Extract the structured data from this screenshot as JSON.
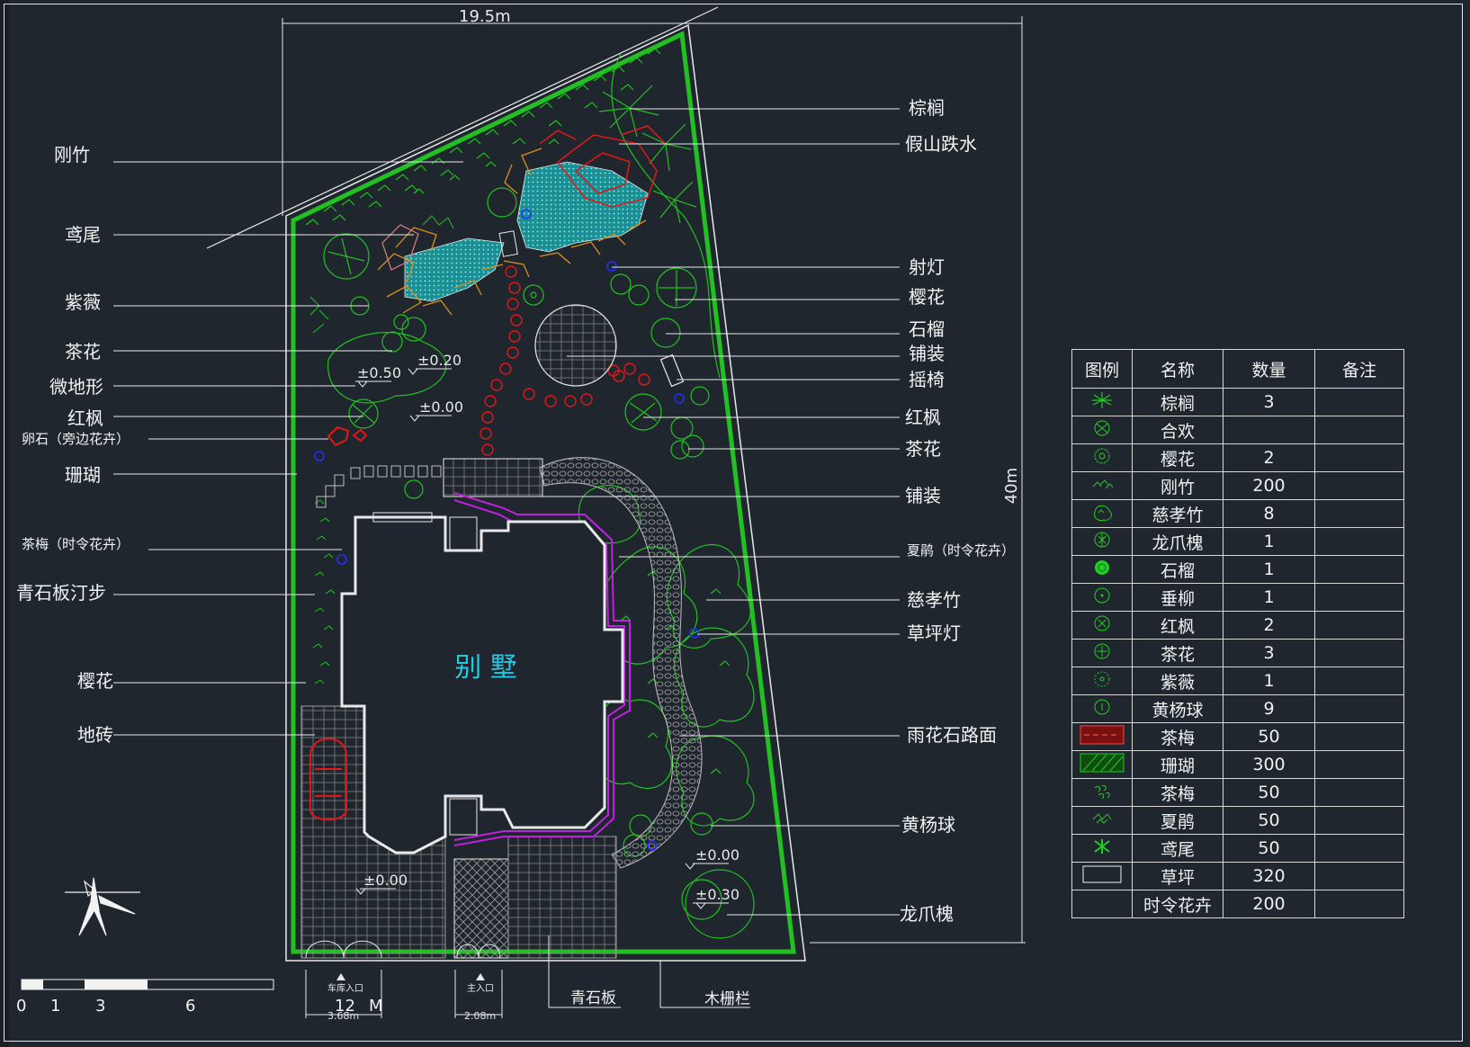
{
  "drawing": {
    "width_dim": "19.5m",
    "height_dim": "40m",
    "villa_label": "别  墅",
    "garage_entrance": "车库入口",
    "main_entrance": "主入口",
    "garage_dim": "3.68m",
    "main_dim": "2.08m",
    "scale_labels": [
      "0",
      "1",
      "3",
      "6",
      "12",
      "M"
    ],
    "elevations": [
      "±0.50",
      "±0.20",
      "±0.00",
      "±0.00",
      "±0.00",
      "±0.30"
    ]
  },
  "left_labels": [
    "刚竹",
    "鸢尾",
    "紫薇",
    "茶花",
    "微地形",
    "红枫",
    "卵石（旁边花卉）",
    "珊瑚",
    "茶梅（时令花卉）",
    "青石板汀步",
    "樱花",
    "地砖"
  ],
  "right_labels": [
    "棕榈",
    "假山跌水",
    "射灯",
    "樱花",
    "石榴",
    "铺装",
    "摇椅",
    "红枫",
    "茶花",
    "铺装",
    "夏鹃（时令花卉）",
    "慈孝竹",
    "草坪灯",
    "雨花石路面",
    "黄杨球",
    "龙爪槐"
  ],
  "bottom_labels": [
    "青石板",
    "木栅栏"
  ],
  "legend": {
    "headers": [
      "图例",
      "名称",
      "数量",
      "备注"
    ],
    "rows": [
      {
        "name": "棕榈",
        "qty": "3",
        "icon": "palm-icon"
      },
      {
        "name": "合欢",
        "qty": "",
        "icon": "albizia-icon"
      },
      {
        "name": "樱花",
        "qty": "2",
        "icon": "cherry-icon"
      },
      {
        "name": "刚竹",
        "qty": "200",
        "icon": "bamboo-icon"
      },
      {
        "name": "慈孝竹",
        "qty": "8",
        "icon": "clump-bamboo-icon"
      },
      {
        "name": "龙爪槐",
        "qty": "1",
        "icon": "pagoda-tree-icon"
      },
      {
        "name": "石榴",
        "qty": "1",
        "icon": "pomegranate-icon"
      },
      {
        "name": "垂柳",
        "qty": "1",
        "icon": "willow-icon"
      },
      {
        "name": "红枫",
        "qty": "2",
        "icon": "maple-icon"
      },
      {
        "name": "茶花",
        "qty": "3",
        "icon": "camellia-icon"
      },
      {
        "name": "紫薇",
        "qty": "1",
        "icon": "crape-myrtle-icon"
      },
      {
        "name": "黄杨球",
        "qty": "9",
        "icon": "boxwood-icon"
      },
      {
        "name": "茶梅",
        "qty": "50",
        "icon": "sasanqua-hatch-icon"
      },
      {
        "name": "珊瑚",
        "qty": "300",
        "icon": "coral-hatch-icon"
      },
      {
        "name": "茶梅",
        "qty": "50",
        "icon": "sasanqua-icon"
      },
      {
        "name": "夏鹃",
        "qty": "50",
        "icon": "azalea-icon"
      },
      {
        "name": "鸢尾",
        "qty": "50",
        "icon": "iris-icon"
      },
      {
        "name": "草坪",
        "qty": "320",
        "icon": "lawn-icon"
      },
      {
        "name": "时令花卉",
        "qty": "200",
        "icon": ""
      }
    ]
  },
  "colors": {
    "background": "#20262e",
    "line_white": "#e8e8e8",
    "plant_green": "#22c022",
    "water_cyan": "#1aa8a8",
    "rock_red": "#e01818",
    "rock_orange": "#d89018",
    "path_purple": "#c020e0",
    "label_cyan": "#28c8e0"
  }
}
